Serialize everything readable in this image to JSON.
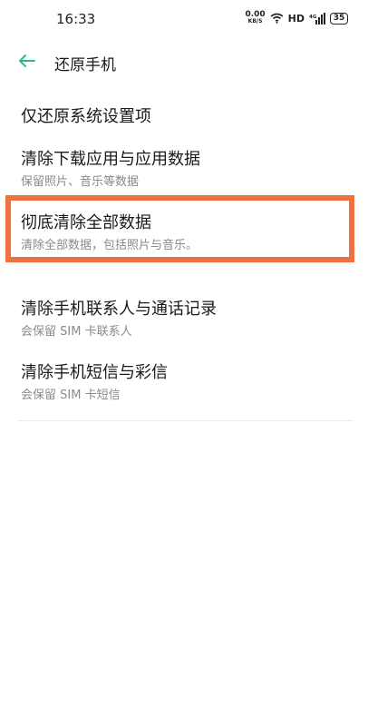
{
  "status_bar": {
    "time": "16:33",
    "net_speed_value": "0.00",
    "net_speed_unit": "KB/S",
    "network_type": "HD",
    "battery_level": "35"
  },
  "header": {
    "title": "还原手机"
  },
  "menu": {
    "items": [
      {
        "title": "仅还原系统设置项",
        "subtitle": ""
      },
      {
        "title": "清除下载应用与应用数据",
        "subtitle": "保留照片、音乐等数据"
      },
      {
        "title": "彻底清除全部数据",
        "subtitle": "清除全部数据，包括照片与音乐。"
      },
      {
        "title": "清除手机联系人与通话记录",
        "subtitle": "会保留 SIM 卡联系人"
      },
      {
        "title": "清除手机短信与彩信",
        "subtitle": "会保留 SIM 卡短信"
      }
    ]
  },
  "colors": {
    "accent": "#2fb98a",
    "highlight_border": "#ef7040",
    "subtitle_text": "#8a8a8a"
  }
}
